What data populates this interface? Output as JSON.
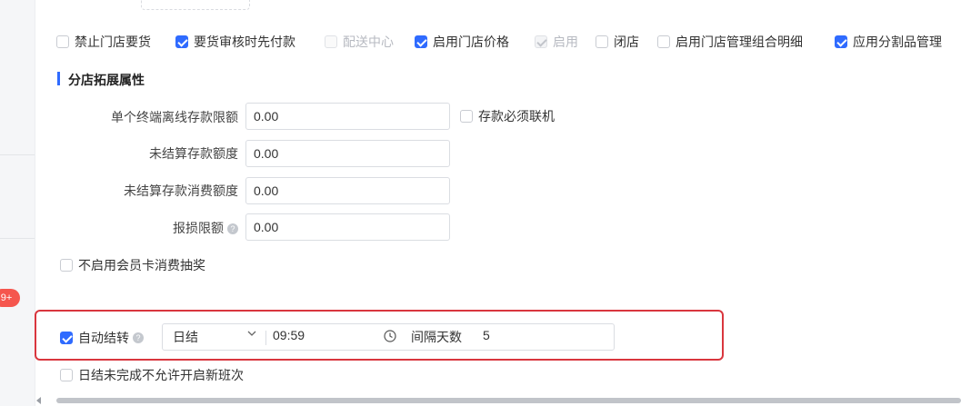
{
  "badge": {
    "text": "9+"
  },
  "top_options": [
    {
      "label": "禁止门店要货",
      "checked": false,
      "disabled": false
    },
    {
      "label": "要货审核时先付款",
      "checked": true,
      "disabled": false
    },
    {
      "label": "配送中心",
      "checked": false,
      "disabled": true
    },
    {
      "label": "启用门店价格",
      "checked": true,
      "disabled": false
    },
    {
      "label": "启用",
      "checked": true,
      "disabled": true
    },
    {
      "label": "闭店",
      "checked": false,
      "disabled": false
    },
    {
      "label": "启用门店管理组合明细",
      "checked": false,
      "disabled": false
    },
    {
      "label": "应用分割品管理",
      "checked": true,
      "disabled": false
    }
  ],
  "section": {
    "title": "分店拓展属性"
  },
  "fields": {
    "offline_limit": {
      "label": "单个终端离线存款限额",
      "value": "0.00"
    },
    "deposit_online": {
      "label": "存款必须联机",
      "checked": false
    },
    "unsettled_amount": {
      "label": "未结算存款额度",
      "value": "0.00"
    },
    "unsettled_consume": {
      "label": "未结算存款消费额度",
      "value": "0.00"
    },
    "loss_limit": {
      "label": "报损限额",
      "value": "0.00"
    },
    "no_member_lottery": {
      "label": "不启用会员卡消费抽奖",
      "checked": false
    }
  },
  "auto_transfer": {
    "label": "自动结转",
    "checked": true,
    "mode": "日结",
    "time": "09:59",
    "interval_label": "间隔天数",
    "interval_value": "5"
  },
  "daily_incomplete": {
    "label": "日结未完成不允许开启新班次",
    "checked": false
  },
  "colors": {
    "accent": "#2f6bff",
    "highlight": "#d9363e",
    "badge": "#f5564e"
  }
}
